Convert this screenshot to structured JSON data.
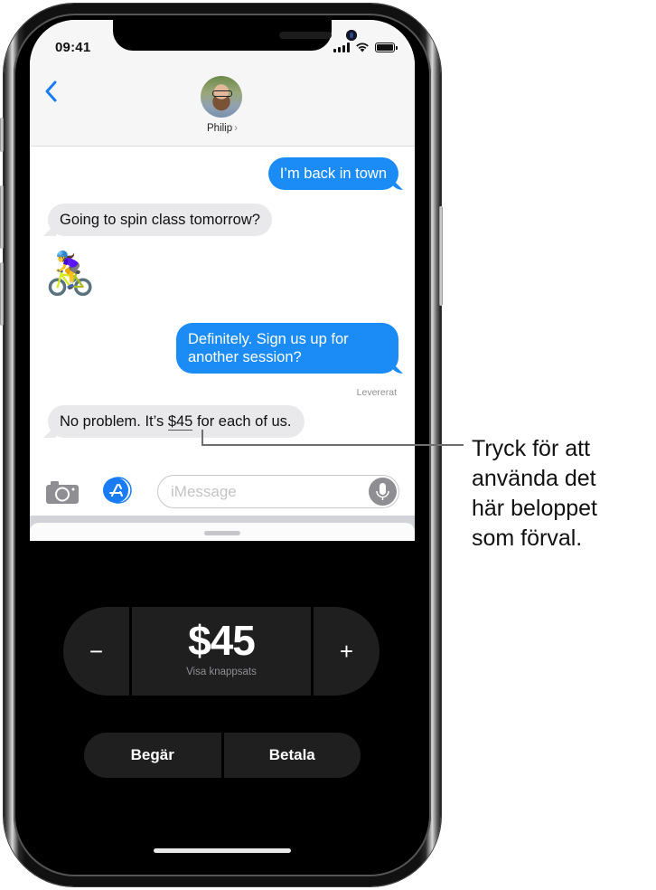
{
  "status_bar": {
    "time": "09:41"
  },
  "header": {
    "back_icon": "chevron-left-icon",
    "contact_name": "Philip",
    "contact_chevron": "›"
  },
  "messages": [
    {
      "direction": "outgoing",
      "text": "I’m back in town"
    },
    {
      "direction": "incoming",
      "text": "Going to spin class tomorrow?"
    },
    {
      "direction": "incoming",
      "type": "emoji",
      "text": "🚴‍♀️"
    },
    {
      "direction": "outgoing",
      "text": "Definitely. Sign us up for another session?"
    },
    {
      "direction": "incoming",
      "text_before": "No problem. It’s ",
      "amount_link": "$45",
      "text_after": " for each of us."
    }
  ],
  "delivery_status": "Levererat",
  "composer": {
    "camera_icon": "camera-icon",
    "apps_icon": "app-store-icon",
    "placeholder": "iMessage",
    "value": "",
    "mic_icon": "microphone-icon"
  },
  "apple_pay": {
    "decrement_label": "−",
    "increment_label": "+",
    "amount": "$45",
    "keypad_label": "Visa knappsats",
    "request_label": "Begär",
    "pay_label": "Betala"
  },
  "callout": {
    "text": "Tryck för att\nanvända det\nhär beloppet\nsom förval."
  },
  "colors": {
    "imessage_blue": "#1b8cf5",
    "incoming_gray": "#e9e9eb",
    "ios_link_blue": "#1a7cf5",
    "pay_button_bg": "#1f1f1f"
  }
}
